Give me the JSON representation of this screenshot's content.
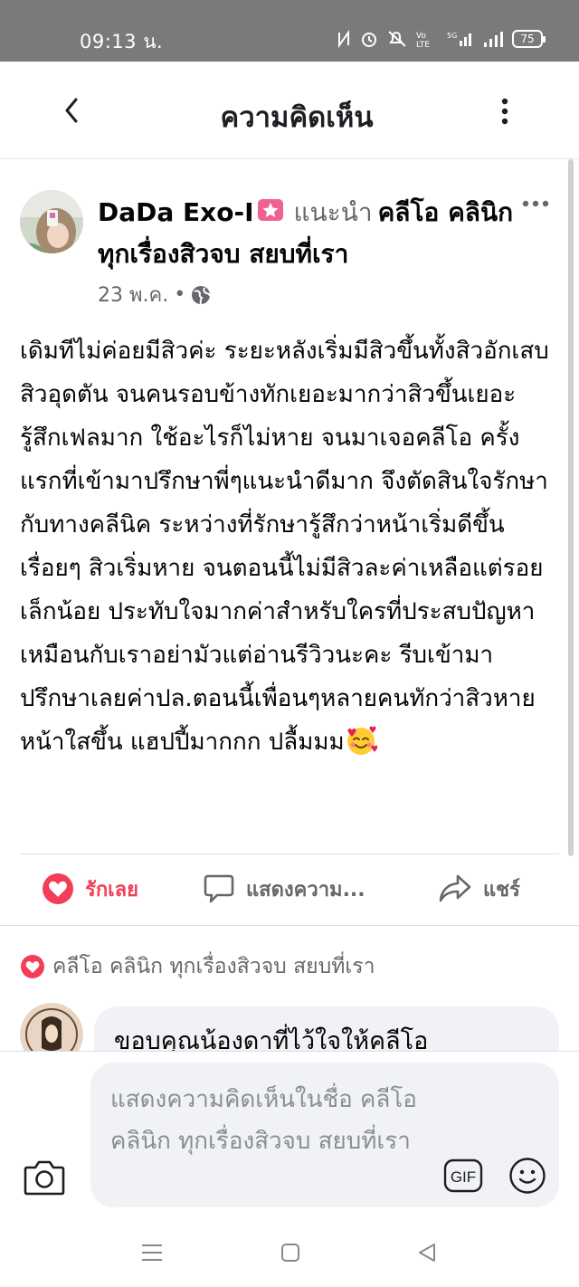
{
  "status_bar": {
    "time": "09:13 น.",
    "battery": "75",
    "network": "5G"
  },
  "header": {
    "title": "ความคิดเห็น"
  },
  "post": {
    "author": "DaDa Exo-I",
    "recommends_text": "แนะนำ",
    "page_name": "คลีโอ คลินิก ทุกเรื่องสิวจบ สยบที่เรา",
    "date": "23 พ.ค.",
    "separator": "•",
    "body": "เดิมทีไม่ค่อยมีสิวค่ะ ระยะหลังเริ่มมีสิวขึ้นทั้งสิวอักเสบ สิวอุดตัน จนคนรอบข้างทักเยอะมากว่าสิวขึ้นเยอะ  รู้สึกเฟลมาก ใช้อะไรก็ไม่หาย จนมาเจอคลีโอ ครั้งแรกที่เข้ามาปรึกษาพี่ๆแนะนำดีมาก จึงตัดสินใจรักษากับทางคลีนิค ระหว่างที่รักษารู้สึกว่าหน้าเริ่มดีขึ้นเรื่อยๆ สิวเริ่มหาย จนตอนนี้ไม่มีสิวละค่าเหลือแต่รอยเล็กน้อย ประทับใจมากค่าสำหรับใครที่ประสบปัญหาเหมือนกับเราอย่ามัวแต่อ่านรีวิวนะคะ รีบเข้ามาปรึกษาเลยค่าปล.ตอนนี้เพื่อนๆหลายคนทักว่าสิวหาย หน้าใสขึ้น แฮปปี้มากกก ปลื้มมม",
    "body_emoji": "smiling-face-with-hearts-icon"
  },
  "actions": {
    "love_label": "รักเลย",
    "comment_label": "แสดงความ...",
    "share_label": "แชร์"
  },
  "liked_by": {
    "text": "คลีโอ คลินิก ทุกเรื่องสิวจบ สยบที่เรา"
  },
  "reply": {
    "text": "ขอบคุณน้องดาที่ไว้ใจให้คลีโอ"
  },
  "composer": {
    "placeholder": "แสดงความคิดเห็นในชื่อ คลีโอ คลินิก ทุกเรื่องสิวจบ สยบที่เรา",
    "gif_label": "GIF"
  },
  "colors": {
    "love": "#f33e58",
    "muted": "#65676b",
    "bubble": "#f0f2f5",
    "status_bar": "#7a7a7a"
  }
}
